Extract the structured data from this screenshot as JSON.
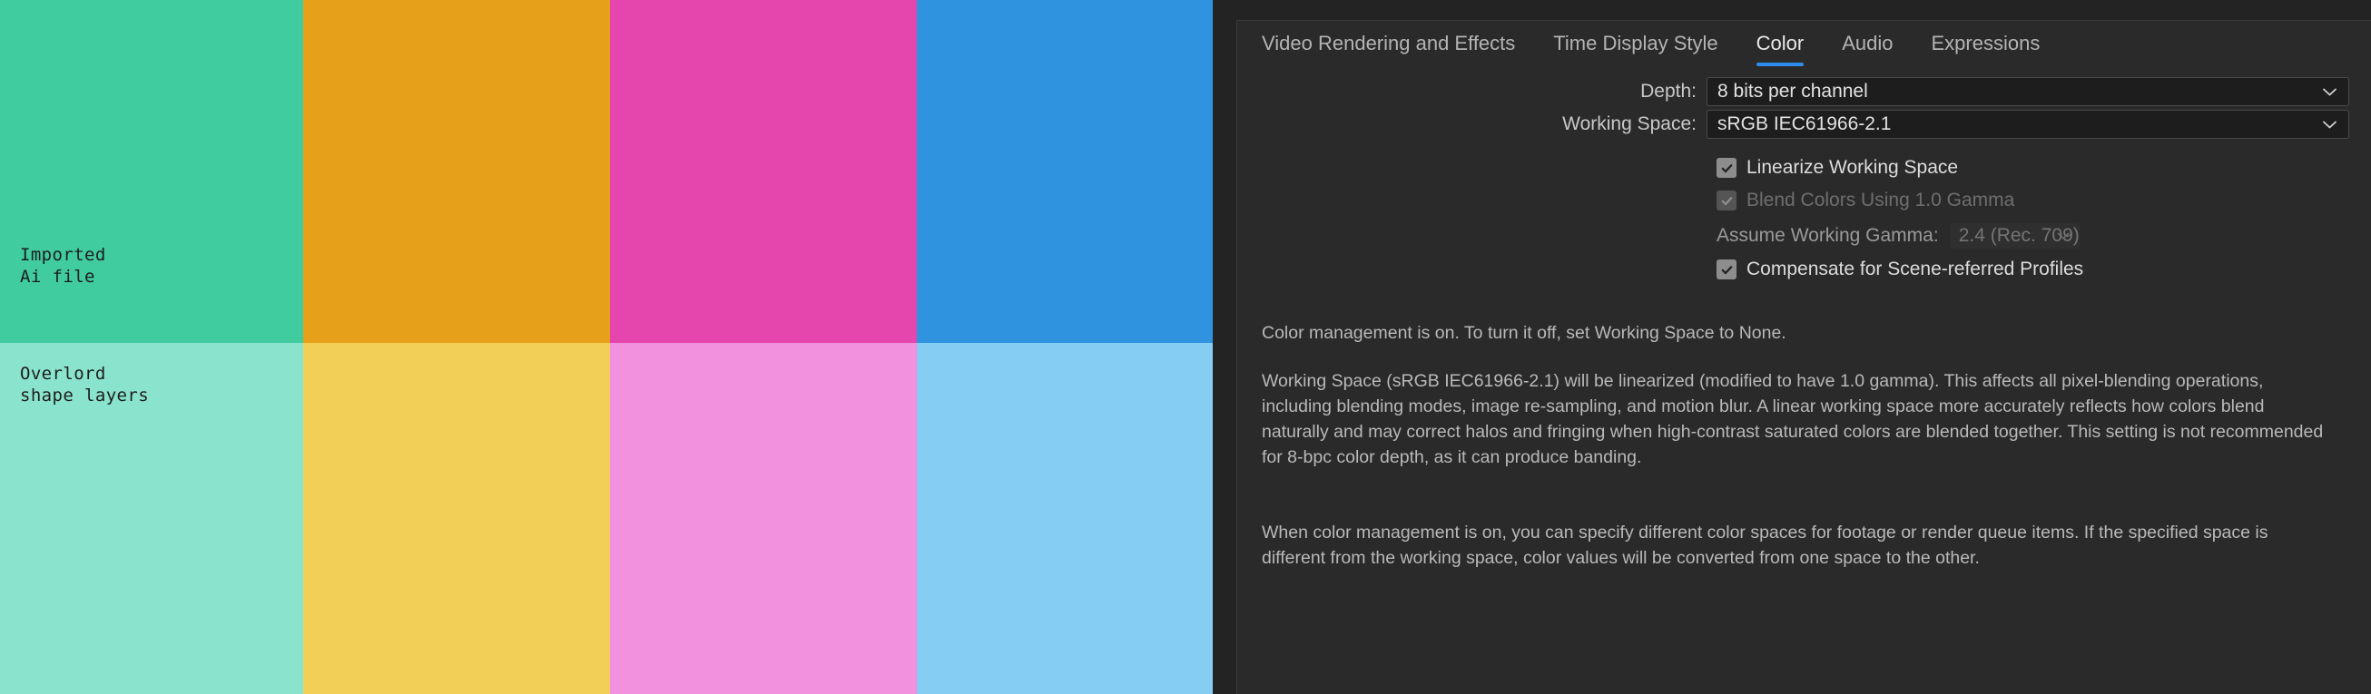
{
  "swatch_grid": {
    "rows": [
      {
        "name": "top-row",
        "cells": [
          {
            "color": "#40cc9e",
            "label": "Imported\nAi file"
          },
          {
            "color": "#e6a01a",
            "label": ""
          },
          {
            "color": "#e446ad",
            "label": ""
          },
          {
            "color": "#2f93e0",
            "label": ""
          }
        ]
      },
      {
        "name": "bottom-row",
        "cells": [
          {
            "color": "#8ae3cc",
            "label": "Overlord\nshape layers"
          },
          {
            "color": "#f2d057",
            "label": ""
          },
          {
            "color": "#f291dd",
            "label": ""
          },
          {
            "color": "#85cdf3",
            "label": ""
          }
        ]
      }
    ]
  },
  "panel": {
    "tabs": [
      {
        "label": "Video Rendering and Effects",
        "active": false
      },
      {
        "label": "Time Display Style",
        "active": false
      },
      {
        "label": "Color",
        "active": true
      },
      {
        "label": "Audio",
        "active": false
      },
      {
        "label": "Expressions",
        "active": false
      }
    ],
    "accent_color": "#2d8ceb",
    "fields": {
      "depth": {
        "label": "Depth:",
        "value": "8 bits per channel",
        "icon": "chevron-down-icon"
      },
      "working_space": {
        "label": "Working Space:",
        "value": "sRGB IEC61966-2.1",
        "icon": "chevron-down-icon"
      }
    },
    "checkboxes": [
      {
        "label": "Linearize Working Space",
        "checked": true,
        "enabled": true
      },
      {
        "label": "Blend Colors Using 1.0 Gamma",
        "checked": true,
        "enabled": false
      }
    ],
    "gamma": {
      "label": "Assume Working Gamma:",
      "value": "2.4 (Rec. 709)",
      "enabled": false,
      "icon": "chevron-down-icon"
    },
    "compensate": {
      "label": "Compensate for Scene-referred Profiles",
      "checked": true,
      "enabled": true
    },
    "descriptions": {
      "p1": "Color management is on. To turn it off, set Working Space to None.",
      "p2": "Working Space (sRGB IEC61966-2.1) will be linearized (modified to have 1.0 gamma). This affects all pixel-blending operations, including blending modes, image re-sampling, and motion blur. A linear working space more accurately reflects how colors blend naturally and may correct halos and fringing when high-contrast saturated colors are blended together. This setting is not recommended for 8-bpc color depth, as it can produce banding.",
      "p3": "When color management is on, you can specify different color spaces for footage or render queue items. If the specified space is different from the working space, color values will be converted from one space to the other."
    }
  }
}
